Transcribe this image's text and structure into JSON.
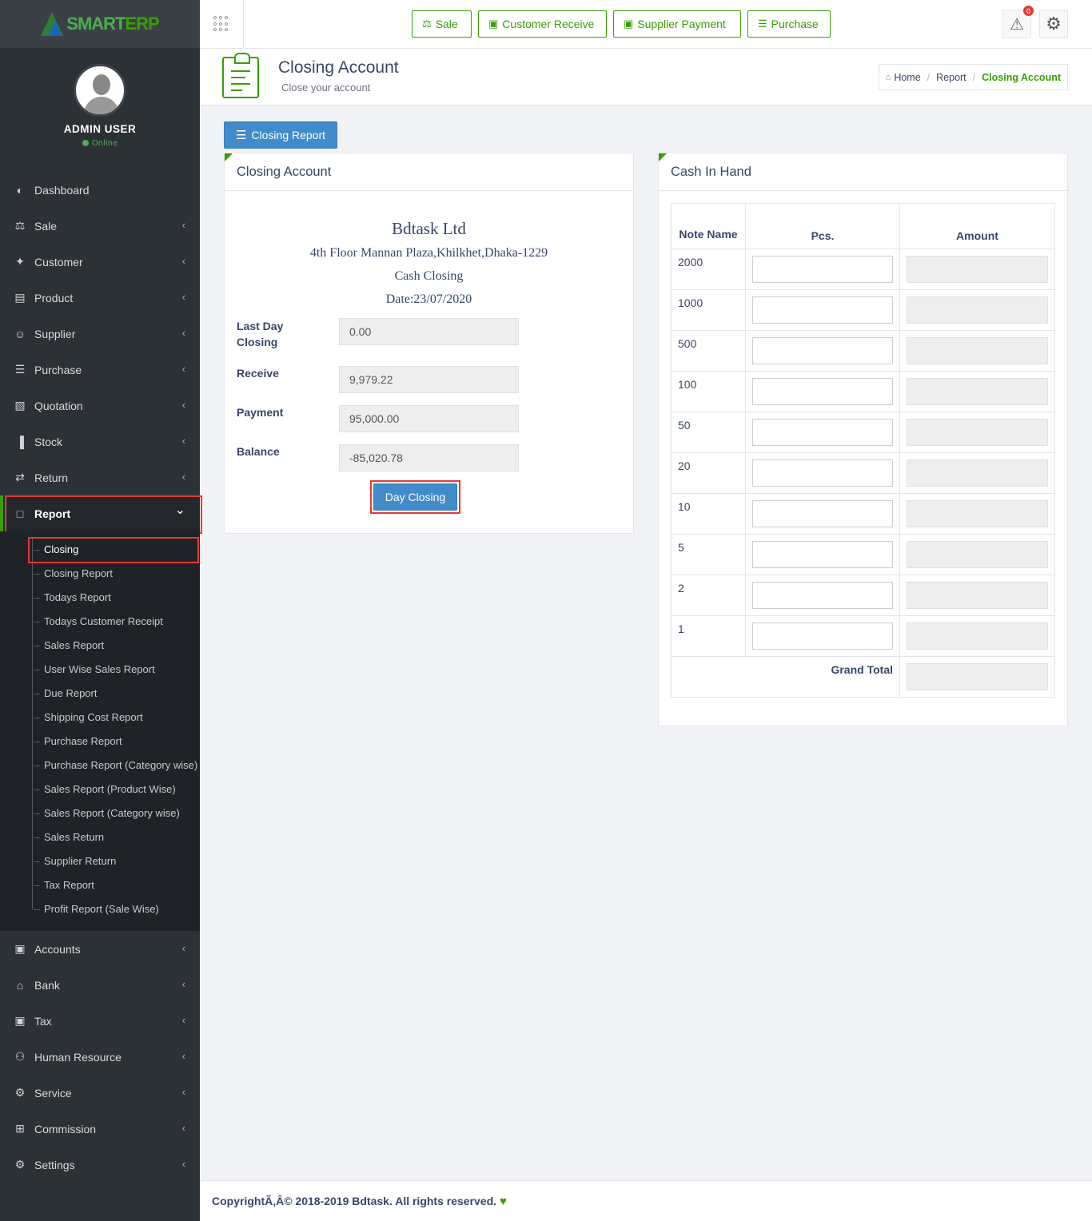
{
  "brand": {
    "logo_main": "SMART",
    "logo_accent": "ERP"
  },
  "user": {
    "name": "ADMIN USER",
    "status": "Online"
  },
  "sidebar": {
    "items": [
      {
        "id": "dashboard",
        "label": "Dashboard",
        "icon": "dashboard-icon",
        "glyph": "◐",
        "has_children": false
      },
      {
        "id": "sale",
        "label": "Sale",
        "icon": "balance-scale-icon",
        "glyph": "⚖",
        "has_children": true
      },
      {
        "id": "customer",
        "label": "Customer",
        "icon": "handshake-icon",
        "glyph": "✦",
        "has_children": true
      },
      {
        "id": "product",
        "label": "Product",
        "icon": "box-icon",
        "glyph": "▤",
        "has_children": true
      },
      {
        "id": "supplier",
        "label": "Supplier",
        "icon": "user-icon",
        "glyph": "☺",
        "has_children": true
      },
      {
        "id": "purchase",
        "label": "Purchase",
        "icon": "cart-icon",
        "glyph": "☰",
        "has_children": true
      },
      {
        "id": "quotation",
        "label": "Quotation",
        "icon": "book-icon",
        "glyph": "▧",
        "has_children": true
      },
      {
        "id": "stock",
        "label": "Stock",
        "icon": "bar-chart-icon",
        "glyph": "▐",
        "has_children": true
      },
      {
        "id": "return",
        "label": "Return",
        "icon": "retweet-icon",
        "glyph": "⇄",
        "has_children": true
      },
      {
        "id": "report",
        "label": "Report",
        "icon": "open-book-icon",
        "glyph": "□",
        "has_children": true,
        "expanded": true
      }
    ],
    "report_children": [
      "Closing",
      "Closing Report",
      "Todays Report",
      "Todays Customer Receipt",
      "Sales Report",
      "User Wise Sales Report",
      "Due Report",
      "Shipping Cost Report",
      "Purchase Report",
      "Purchase Report (Category wise)",
      "Sales Report (Product Wise)",
      "Sales Report (Category wise)",
      "Sales Return",
      "Supplier Return",
      "Tax Report",
      "Profit Report (Sale Wise)"
    ],
    "bottom_items": [
      {
        "id": "accounts",
        "label": "Accounts",
        "icon": "money-icon",
        "glyph": "▣"
      },
      {
        "id": "bank",
        "label": "Bank",
        "icon": "bank-icon",
        "glyph": "⌂"
      },
      {
        "id": "tax",
        "label": "Tax",
        "icon": "money-icon",
        "glyph": "▣"
      },
      {
        "id": "human-resource",
        "label": "Human Resource",
        "icon": "users-icon",
        "glyph": "⚇"
      },
      {
        "id": "service",
        "label": "Service",
        "icon": "cogs-icon",
        "glyph": "⚙"
      },
      {
        "id": "commission",
        "label": "Commission",
        "icon": "grid-icon",
        "glyph": "⊞"
      },
      {
        "id": "settings",
        "label": "Settings",
        "icon": "gear-icon",
        "glyph": "⚙"
      }
    ]
  },
  "topbar": {
    "quick_buttons": [
      {
        "label": "Sale",
        "icon": "balance-scale-icon",
        "glyph": "⚖"
      },
      {
        "label": "Customer Receive",
        "icon": "money-icon",
        "glyph": "▣"
      },
      {
        "label": "Supplier Payment",
        "icon": "money-icon",
        "glyph": "▣"
      },
      {
        "label": "Purchase",
        "icon": "cart-icon",
        "glyph": "☰"
      }
    ],
    "alert_count": "0"
  },
  "header": {
    "title": "Closing Account",
    "subtitle": "Close your account",
    "breadcrumb": {
      "home": "Home",
      "parent": "Report",
      "current": "Closing Account"
    }
  },
  "actions": {
    "closing_report_label": "Closing Report"
  },
  "closing_panel": {
    "heading": "Closing Account",
    "company": "Bdtask Ltd",
    "address": "4th Floor Mannan Plaza,Khilkhet,Dhaka-1229",
    "doc_title": "Cash Closing",
    "date": "Date:23/07/2020",
    "fields": {
      "last_day_closing_label": "Last Day Closing",
      "last_day_closing_value": "0.00",
      "receive_label": "Receive",
      "receive_value": "9,979.22",
      "payment_label": "Payment",
      "payment_value": "95,000.00",
      "balance_label": "Balance",
      "balance_value": "-85,020.78"
    },
    "submit_label": "Day Closing"
  },
  "cash_panel": {
    "heading": "Cash In Hand",
    "columns": [
      "Note Name",
      "Pcs.",
      "Amount"
    ],
    "notes": [
      "2000",
      "1000",
      "500",
      "100",
      "50",
      "20",
      "10",
      "5",
      "2",
      "1"
    ],
    "grand_total_label": "Grand Total"
  },
  "footer": {
    "copyright": "CopyrightÃ‚Â© 2018-2019 Bdtask. All rights reserved."
  },
  "colors": {
    "accent": "#37a000",
    "primary": "#428bca",
    "sidebar": "#2c3136",
    "highlight": "#e53935"
  }
}
